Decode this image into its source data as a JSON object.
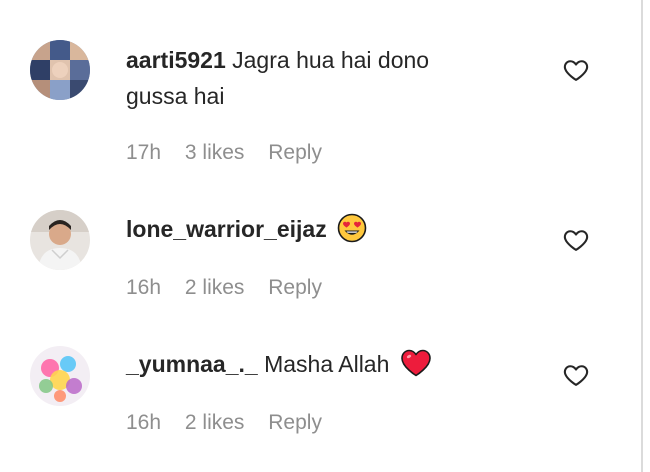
{
  "comments": [
    {
      "username": "aarti5921",
      "text_line1": "Jagra hua hai dono",
      "text_line2": "gussa hai",
      "time": "17h",
      "likes": "3 likes",
      "reply": "Reply",
      "avatar_icon": "avatar-collage-icon",
      "like_icon": "heart-outline-icon"
    },
    {
      "username": "lone_warrior_eijaz",
      "text_line1": "",
      "emoji": "heart-eyes-emoji",
      "time": "16h",
      "likes": "2 likes",
      "reply": "Reply",
      "avatar_icon": "avatar-person-icon",
      "like_icon": "heart-outline-icon"
    },
    {
      "username": "_yumnaa_._",
      "text_line1": "Masha Allah",
      "emoji": "red-heart-emoji",
      "time": "16h",
      "likes": "2 likes",
      "reply": "Reply",
      "avatar_icon": "avatar-colorful-icon",
      "like_icon": "heart-outline-icon"
    }
  ],
  "colors": {
    "text": "#262626",
    "meta": "#8e8e8e",
    "divider": "#dbdbdb",
    "heart_red": "#ed1c3c",
    "emoji_yellow": "#ffc83d"
  }
}
